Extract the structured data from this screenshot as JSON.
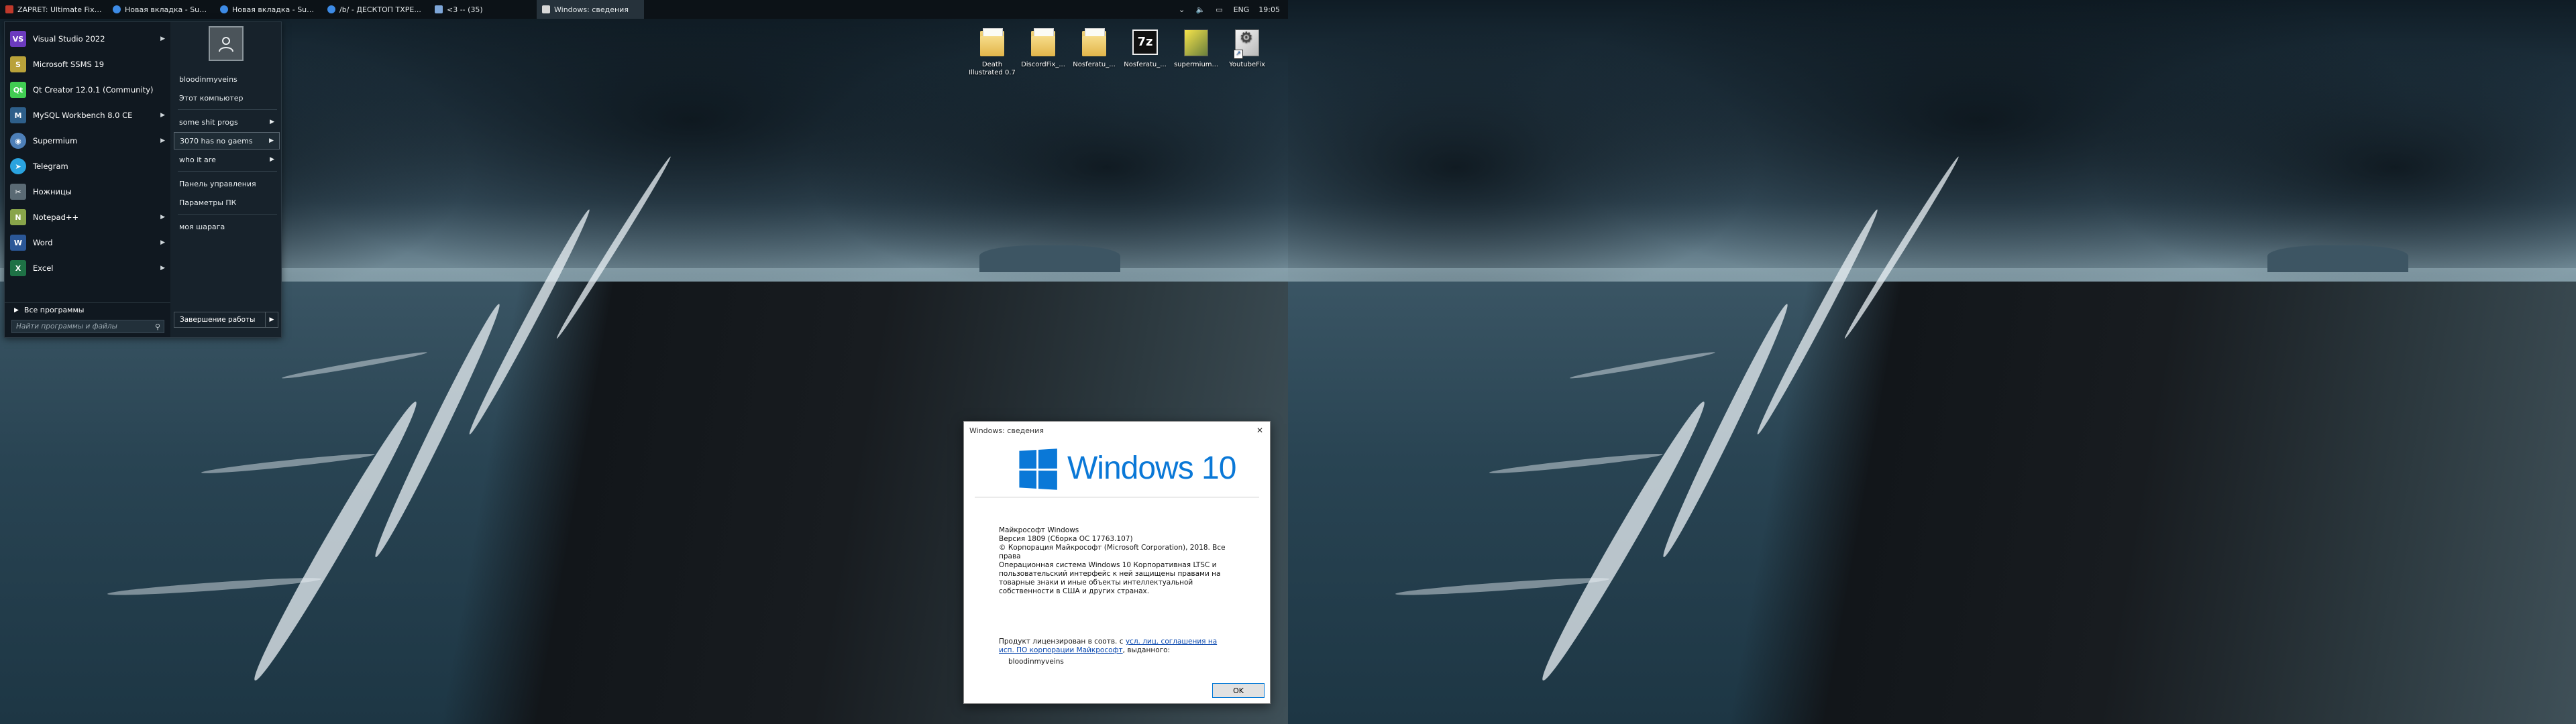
{
  "taskbar": {
    "tasks": [
      {
        "label": "ZAPRET: Ultimate Fix ...",
        "icon": "terminal-icon",
        "color": "#c0392b"
      },
      {
        "label": "Новая вкладка - Sup...",
        "icon": "browser-icon",
        "color": "#3d8be6"
      },
      {
        "label": "Новая вкладка - Sup...",
        "icon": "browser-icon",
        "color": "#3d8be6"
      },
      {
        "label": "/b/ - ДЕСКТОП ТХРЕ...",
        "icon": "browser-icon",
        "color": "#3d8be6"
      },
      {
        "label": "<3 -- (35)",
        "icon": "chat-icon",
        "color": "#7ea6d8"
      },
      {
        "label": "Windows: сведения",
        "icon": "window-icon",
        "color": "#d8d8d8"
      }
    ],
    "tray": {
      "lang": "ENG",
      "time": "19:05"
    }
  },
  "start_menu": {
    "programs": [
      {
        "label": "Visual Studio 2022",
        "icon": "visual-studio-icon",
        "color": "#6c3bbf",
        "glyph": "VS",
        "submenu": true
      },
      {
        "label": "Microsoft SSMS 19",
        "icon": "ssms-icon",
        "color": "#b9a23a",
        "glyph": "S",
        "submenu": false
      },
      {
        "label": "Qt Creator 12.0.1 (Community)",
        "icon": "qt-creator-icon",
        "color": "#41cd52",
        "glyph": "Qt",
        "submenu": false
      },
      {
        "label": "MySQL Workbench 8.0 CE",
        "icon": "mysql-workbench-icon",
        "color": "#2e5f8a",
        "glyph": "M",
        "submenu": true
      },
      {
        "label": "Supermium",
        "icon": "supermium-icon",
        "color": "#4d7fb8",
        "glyph": "◉",
        "submenu": true
      },
      {
        "label": "Telegram",
        "icon": "telegram-icon",
        "color": "#2aa3df",
        "glyph": "➤",
        "submenu": false
      },
      {
        "label": "Ножницы",
        "icon": "scissors-icon",
        "color": "#5a6a74",
        "glyph": "✂",
        "submenu": false
      },
      {
        "label": "Notepad++",
        "icon": "notepad-plus-icon",
        "color": "#88a44a",
        "glyph": "N",
        "submenu": true
      },
      {
        "label": "Word",
        "icon": "word-icon",
        "color": "#2b5797",
        "glyph": "W",
        "submenu": true
      },
      {
        "label": "Excel",
        "icon": "excel-icon",
        "color": "#1e7145",
        "glyph": "X",
        "submenu": true
      }
    ],
    "all_programs": "Все программы",
    "search_placeholder": "Найти программы и файлы",
    "user": "bloodinmyveins",
    "links": {
      "computer": "Этот компьютер",
      "folder1": "some shit progs",
      "folder2": "3070 has no gaems",
      "folder3": "who it are",
      "control_panel": "Панель управления",
      "settings": "Параметры ПК",
      "share": "моя шарага"
    },
    "shutdown": "Завершение работы"
  },
  "desktop_icons": [
    {
      "label": "Death Illustrated 0.7",
      "type": "folder"
    },
    {
      "label": "DiscordFix_...",
      "type": "folder"
    },
    {
      "label": "Nosferatu_...",
      "type": "folder-doc"
    },
    {
      "label": "Nosferatu_...",
      "type": "7z"
    },
    {
      "label": "supermium...",
      "type": "sumatra"
    },
    {
      "label": "YoutubeFix",
      "type": "batch"
    }
  ],
  "dialog": {
    "title": "Windows: сведения",
    "logo_text": "Windows 10",
    "line1": "Майкрософт Windows",
    "line2": "Версия 1809 (Сборка ОС 17763.107)",
    "line3": "© Корпорация Майкрософт (Microsoft Corporation), 2018. Все права",
    "para1": "Операционная система Windows 10 Корпоративная LTSC и пользовательский интерфейс к ней защищены правами на товарные знаки и иные объекты интеллектуальной собственности в США и других странах.",
    "license_prefix": "Продукт лицензирован в соотв. с ",
    "license_link": "усл. лиц. соглашения на исп. ПО корпорации Майкрософт",
    "license_suffix": ", выданного:",
    "licensee": "bloodinmyveins",
    "ok": "OK",
    "logo_color": "#0a78d7"
  }
}
